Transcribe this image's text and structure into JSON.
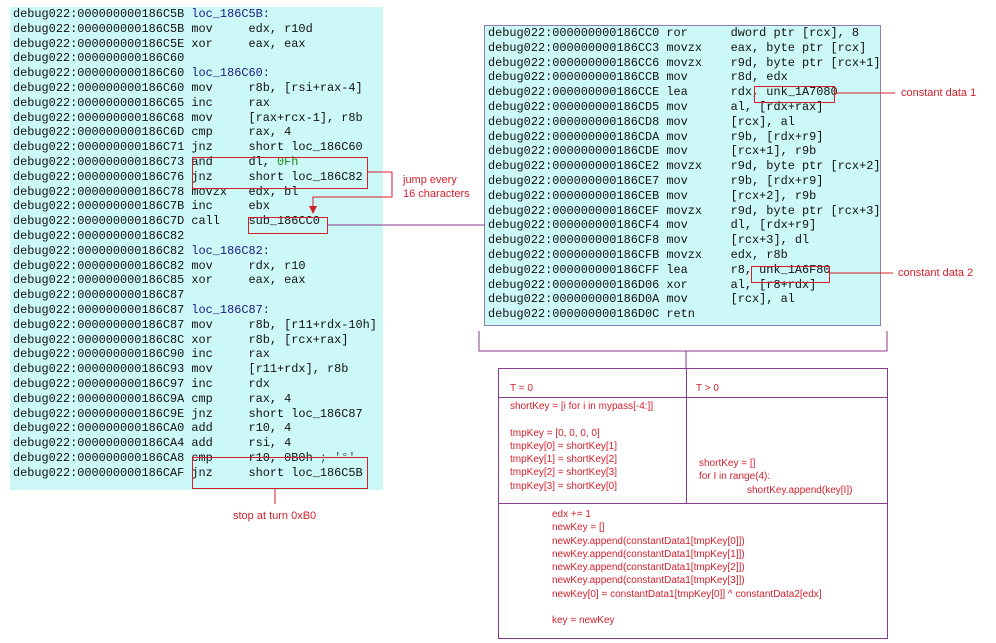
{
  "left_code": [
    {
      "addr": "debug022:000000000186C5B",
      "lab": "loc_186C5B:"
    },
    {
      "addr": "debug022:000000000186C5B",
      "op": "mov",
      "args": "edx, r10d"
    },
    {
      "addr": "debug022:000000000186C5E",
      "op": "xor",
      "args": "eax, eax"
    },
    {
      "addr": "debug022:000000000186C60"
    },
    {
      "addr": "debug022:000000000186C60",
      "lab": "loc_186C60:"
    },
    {
      "addr": "debug022:000000000186C60",
      "op": "mov",
      "args": "r8b, [rsi+rax-4]"
    },
    {
      "addr": "debug022:000000000186C65",
      "op": "inc",
      "args": "rax"
    },
    {
      "addr": "debug022:000000000186C68",
      "op": "mov",
      "args": "[rax+rcx-1], r8b"
    },
    {
      "addr": "debug022:000000000186C6D",
      "op": "cmp",
      "args": "rax, 4"
    },
    {
      "addr": "debug022:000000000186C71",
      "op": "jnz",
      "args": "short loc_186C60"
    },
    {
      "addr": "debug022:000000000186C73",
      "op": "and",
      "args": "dl, ",
      "grn": "0Fh"
    },
    {
      "addr": "debug022:000000000186C76",
      "op": "jnz",
      "args": "short loc_186C82"
    },
    {
      "addr": "debug022:000000000186C78",
      "op": "movzx",
      "args": "edx, bl"
    },
    {
      "addr": "debug022:000000000186C7B",
      "op": "inc",
      "args": "ebx"
    },
    {
      "addr": "debug022:000000000186C7D",
      "op": "call",
      "args": "sub_186CC0"
    },
    {
      "addr": "debug022:000000000186C82"
    },
    {
      "addr": "debug022:000000000186C82",
      "lab": "loc_186C82:"
    },
    {
      "addr": "debug022:000000000186C82",
      "op": "mov",
      "args": "rdx, r10"
    },
    {
      "addr": "debug022:000000000186C85",
      "op": "xor",
      "args": "eax, eax"
    },
    {
      "addr": "debug022:000000000186C87"
    },
    {
      "addr": "debug022:000000000186C87",
      "lab": "loc_186C87:"
    },
    {
      "addr": "debug022:000000000186C87",
      "op": "mov",
      "args": "r8b, [r11+rdx-10h]"
    },
    {
      "addr": "debug022:000000000186C8C",
      "op": "xor",
      "args": "r8b, [rcx+rax]"
    },
    {
      "addr": "debug022:000000000186C90",
      "op": "inc",
      "args": "rax"
    },
    {
      "addr": "debug022:000000000186C93",
      "op": "mov",
      "args": "[r11+rdx], r8b"
    },
    {
      "addr": "debug022:000000000186C97",
      "op": "inc",
      "args": "rdx"
    },
    {
      "addr": "debug022:000000000186C9A",
      "op": "cmp",
      "args": "rax, 4"
    },
    {
      "addr": "debug022:000000000186C9E",
      "op": "jnz",
      "args": "short loc_186C87"
    },
    {
      "addr": "debug022:000000000186CA0",
      "op": "add",
      "args": "r10, 4"
    },
    {
      "addr": "debug022:000000000186CA4",
      "op": "add",
      "args": "rsi, 4"
    },
    {
      "addr": "debug022:000000000186CA8",
      "op": "cmp",
      "args": "r10, 0B0h ",
      "cmt": "; '°'"
    },
    {
      "addr": "debug022:000000000186CAF",
      "op": "jnz",
      "args": "short loc_186C5B"
    }
  ],
  "right_code": [
    {
      "addr": "debug022:000000000186CC0",
      "op": "ror",
      "args": "dword ptr [rcx], 8"
    },
    {
      "addr": "debug022:000000000186CC3",
      "op": "movzx",
      "args": "eax, byte ptr [rcx]"
    },
    {
      "addr": "debug022:000000000186CC6",
      "op": "movzx",
      "args": "r9d, byte ptr [rcx+1]"
    },
    {
      "addr": "debug022:000000000186CCB",
      "op": "mov",
      "args": "r8d, edx"
    },
    {
      "addr": "debug022:000000000186CCE",
      "op": "lea",
      "args": "rdx, unk_1A7080"
    },
    {
      "addr": "debug022:000000000186CD5",
      "op": "mov",
      "args": "al, [rdx+rax]"
    },
    {
      "addr": "debug022:000000000186CD8",
      "op": "mov",
      "args": "[rcx], al"
    },
    {
      "addr": "debug022:000000000186CDA",
      "op": "mov",
      "args": "r9b, [rdx+r9]"
    },
    {
      "addr": "debug022:000000000186CDE",
      "op": "mov",
      "args": "[rcx+1], r9b"
    },
    {
      "addr": "debug022:000000000186CE2",
      "op": "movzx",
      "args": "r9d, byte ptr [rcx+2]"
    },
    {
      "addr": "debug022:000000000186CE7",
      "op": "mov",
      "args": "r9b, [rdx+r9]"
    },
    {
      "addr": "debug022:000000000186CEB",
      "op": "mov",
      "args": "[rcx+2], r9b"
    },
    {
      "addr": "debug022:000000000186CEF",
      "op": "movzx",
      "args": "r9d, byte ptr [rcx+3]"
    },
    {
      "addr": "debug022:000000000186CF4",
      "op": "mov",
      "args": "dl, [rdx+r9]"
    },
    {
      "addr": "debug022:000000000186CF8",
      "op": "mov",
      "args": "[rcx+3], dl"
    },
    {
      "addr": "debug022:000000000186CFB",
      "op": "movzx",
      "args": "edx, r8b"
    },
    {
      "addr": "debug022:000000000186CFF",
      "op": "lea",
      "args": "r8, unk_1A6F80"
    },
    {
      "addr": "debug022:000000000186D06",
      "op": "xor",
      "args": "al, [r8+rdx]"
    },
    {
      "addr": "debug022:000000000186D0A",
      "op": "mov",
      "args": "[rcx], al"
    },
    {
      "addr": "debug022:000000000186D0C",
      "op": "retn",
      "args": ""
    }
  ],
  "annotations": {
    "jump_every": "jump every\n16 characters",
    "stop_at": "stop at turn 0xB0",
    "constant_data_1": "constant data 1",
    "constant_data_2": "constant data 2"
  },
  "table": {
    "header_t0": "T = 0",
    "header_tgt": "T > 0",
    "t0_code": "shortKey = [i for i in mypass[-4:]]\n\ntmpKey = [0, 0, 0, 0]\ntmpKey[0] = shortKey[1]\ntmpKey[1] = shortKey[2]\ntmpKey[2] = shortKey[3]\ntmpKey[3] = shortKey[0]",
    "tgt_code_1": "shortKey = []\nfor I in range(4):",
    "tgt_code_2": "shortKey.append(key[I])",
    "bottom_code": "edx += 1\nnewKey = []\nnewKey.append(constantData1[tmpKey[0]])\nnewKey.append(constantData1[tmpKey[1]])\nnewKey.append(constantData1[tmpKey[2]])\nnewKey.append(constantData1[tmpKey[3]])\nnewKey[0] = constantData1[tmpKey[0]] ^ constantData2[edx]\n\nkey = newKey"
  },
  "colors": {
    "code_bg": "#cdf8f8",
    "red": "#d41f2a",
    "purple": "#8a3a8a"
  }
}
